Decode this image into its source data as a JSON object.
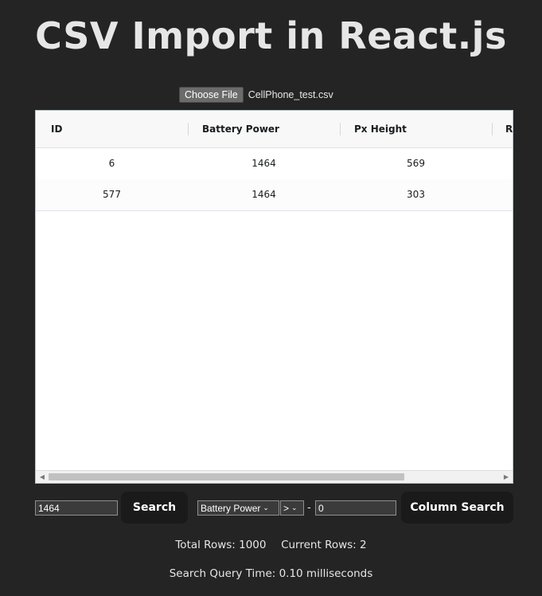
{
  "title": "CSV Import in React.js",
  "file": {
    "button_label": "Choose File",
    "file_name": "CellPhone_test.csv"
  },
  "grid": {
    "columns": [
      "ID",
      "Battery Power",
      "Px Height",
      "Ram"
    ],
    "rows": [
      [
        "6",
        "1464",
        "569"
      ],
      [
        "577",
        "1464",
        "303"
      ]
    ]
  },
  "search": {
    "value": "1464",
    "button_label": "Search"
  },
  "column_search": {
    "column": "Battery Power",
    "operator": ">",
    "separator": "-",
    "value": "0",
    "button_label": "Column Search"
  },
  "stats": {
    "total_rows": "Total Rows: 1000",
    "current_rows": "Current Rows: 2",
    "query_time": "Search Query Time: 0.10 milliseconds"
  },
  "icons": {
    "scroll_left": "◀",
    "scroll_right": "▶",
    "chevron": "⌄"
  }
}
